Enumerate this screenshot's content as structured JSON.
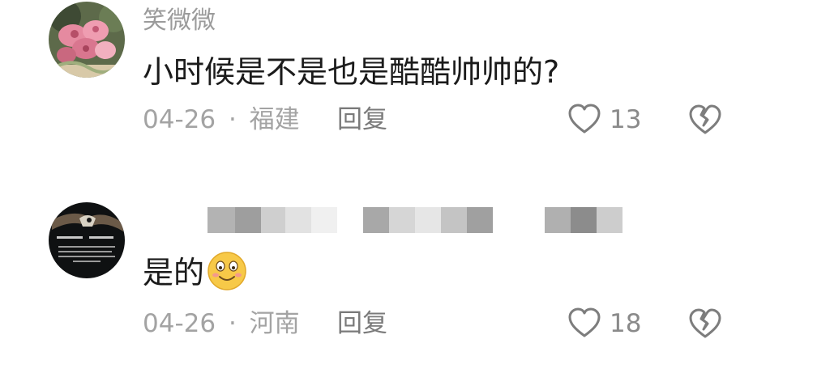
{
  "comments": [
    {
      "username": "笑微微",
      "text": "小时候是不是也是酷酷帅帅的?",
      "date": "04-26",
      "separator": "·",
      "location": "福建",
      "reply_label": "回复",
      "likes": "13",
      "avatar_icon": "flower-bouquet-avatar"
    },
    {
      "username": "",
      "text": "是的",
      "emoji": "smiling-face-emoji",
      "date": "04-26",
      "separator": "·",
      "location": "河南",
      "reply_label": "回复",
      "likes": "18",
      "avatar_icon": "eagle-dark-avatar"
    }
  ],
  "colors": {
    "username": "#9b9b9b",
    "text": "#1b1b1b",
    "meta": "#a3a3a3",
    "icon": "#7d7d7d"
  }
}
